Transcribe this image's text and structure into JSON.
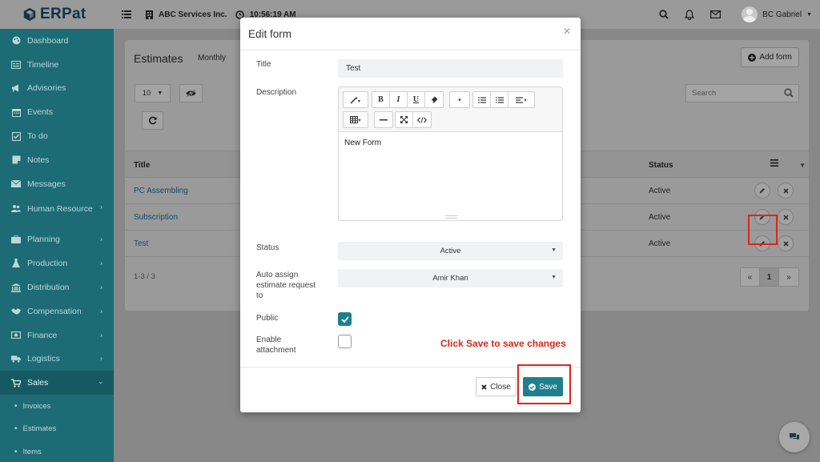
{
  "app": {
    "logo_text": "ERPat",
    "company": "ABC Services Inc.",
    "time": "10:56:19 AM",
    "user_name": "BC Gabriel"
  },
  "sidebar": {
    "items": [
      {
        "label": "Dashboard",
        "icon": "palette-icon"
      },
      {
        "label": "Timeline",
        "icon": "timeline-icon"
      },
      {
        "label": "Advisories",
        "icon": "megaphone-icon"
      },
      {
        "label": "Events",
        "icon": "calendar-icon"
      },
      {
        "label": "To do",
        "icon": "checkbox-icon"
      },
      {
        "label": "Notes",
        "icon": "note-icon"
      },
      {
        "label": "Messages",
        "icon": "envelope-icon"
      },
      {
        "label": "Human Resource",
        "icon": "users-icon"
      },
      {
        "label": "Planning",
        "icon": "briefcase-icon"
      },
      {
        "label": "Production",
        "icon": "flask-icon"
      },
      {
        "label": "Distribution",
        "icon": "bank-icon"
      },
      {
        "label": "Compensation",
        "icon": "handshake-icon"
      },
      {
        "label": "Finance",
        "icon": "money-icon"
      },
      {
        "label": "Logistics",
        "icon": "truck-icon"
      },
      {
        "label": "Sales",
        "icon": "cart-icon"
      }
    ],
    "sub_items": [
      {
        "label": "Invoices"
      },
      {
        "label": "Estimates"
      },
      {
        "label": "Items"
      }
    ]
  },
  "page": {
    "title": "Estimates",
    "tab": "Monthly",
    "add_button": "Add form",
    "per_page": "10",
    "search_placeholder": "Search",
    "columns": {
      "title": "Title",
      "status": "Status"
    },
    "rows": [
      {
        "title": "PC Assembling",
        "status": "Active"
      },
      {
        "title": "Subscription",
        "status": "Active"
      },
      {
        "title": "Test",
        "status": "Active"
      }
    ],
    "pager_info": "1-3 / 3",
    "pager": {
      "prev": "«",
      "current": "1",
      "next": "»"
    }
  },
  "modal": {
    "title": "Edit form",
    "title_label": "Title",
    "title_value": "Test",
    "description_label": "Description",
    "description_value": "New Form",
    "status_label": "Status",
    "status_value": "Active",
    "auto_assign_label": "Auto assign estimate request to",
    "auto_assign_value": "Amir Khan",
    "public_label": "Public",
    "public_checked": true,
    "attachment_label": "Enable attachment",
    "attachment_checked": false,
    "hint": "Click Save to save changes",
    "close_button": "Close",
    "save_button": "Save"
  },
  "colors": {
    "accent": "#1f7f8c",
    "sidebar": "#1d6b74",
    "highlight": "#d9271a",
    "link": "#0e4e68"
  }
}
